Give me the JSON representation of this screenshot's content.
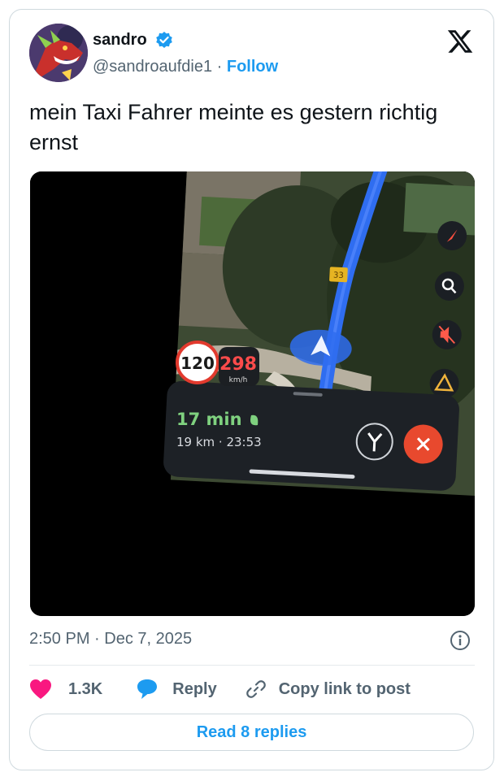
{
  "author": {
    "name": "sandro",
    "handle": "@sandroaufdie1",
    "separator": "·",
    "follow_label": "Follow"
  },
  "tweet": {
    "text": "mein Taxi Fahrer meinte es gestern richtig ernst"
  },
  "media": {
    "speed_limit": "120",
    "current_speed": "298",
    "speed_unit": "km/h",
    "route_sign": "33",
    "eta": "17 min",
    "trip_info": "19 km · 23:53",
    "colors": {
      "route": "#2f6df0",
      "speed_warning": "#ff4b4b",
      "eta_green": "#7fd17f",
      "close_button": "#e8492e"
    }
  },
  "meta": {
    "timestamp": "2:50 PM · Dec 7, 2025"
  },
  "actions": {
    "likes": "1.3K",
    "reply_label": "Reply",
    "copy_label": "Copy link to post",
    "read_replies": "Read 8 replies"
  },
  "colors": {
    "link": "#1d9bf0",
    "like": "#f91880",
    "secondary": "#536471"
  }
}
